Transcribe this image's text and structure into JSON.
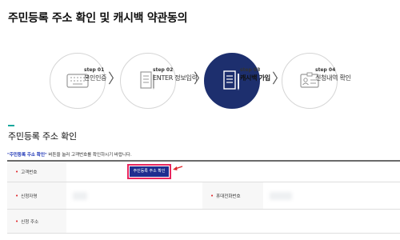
{
  "page": {
    "title": "주민등록 주소 확인 및 캐시백 약관동의"
  },
  "steps": [
    {
      "number": "step 01",
      "label": "본인인증",
      "icon": "keyboard-icon",
      "active": false
    },
    {
      "number": "step 02",
      "label": "ENTER 정보입력",
      "icon": "document-pen-icon",
      "active": false
    },
    {
      "number": "step 03",
      "label": "캐시백 가입",
      "icon": "document-pen-icon",
      "active": true
    },
    {
      "number": "step 04",
      "label": "신청내역 확인",
      "icon": "id-card-icon",
      "active": false
    }
  ],
  "step_separator": "〉",
  "section": {
    "title": "주민등록 주소 확인",
    "notice_highlight": "\"주민등록 주소 확인\"",
    "notice_rest": " 버튼을 눌러 고객번호를 확인하시기 바랍니다."
  },
  "form": {
    "bullet": "•",
    "customer_number_label": "고객번호",
    "confirm_button_label": "주민등록 주소 확인",
    "applicant_label": "신청자명",
    "mobile_label": "휴대전화번호",
    "address_label": "신청 주소"
  },
  "colors": {
    "accent_navy": "#1d2f6e",
    "button_blue": "#1f2d8f",
    "highlight_pink": "#e8265e",
    "section_teal": "#18a79c",
    "required_red": "#e0262a"
  }
}
